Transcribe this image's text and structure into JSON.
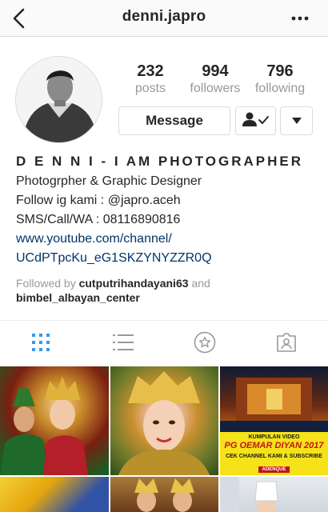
{
  "header": {
    "username": "denni.japro",
    "back_icon": "chevron-left-icon",
    "more_icon": "more-dots-icon"
  },
  "profile": {
    "avatar": "profile-photo",
    "stats": [
      {
        "value": "232",
        "label": "posts"
      },
      {
        "value": "994",
        "label": "followers"
      },
      {
        "value": "796",
        "label": "following"
      }
    ],
    "message_label": "Message",
    "following_icon": "person-check-icon",
    "dropdown_icon": "triangle-down-icon"
  },
  "bio": {
    "name": "D E N N I - I AM PHOTOGRAPHER",
    "lines": [
      "Photogrpher & Graphic Designer",
      "Follow ig kami : @japro.aceh",
      "SMS/Call/WA : 08116890816"
    ],
    "link_line1": "www.youtube.com/channel/",
    "link_line2": "UCdPTpcKu_eG1SKZYNYZZR0Q",
    "followed_prefix": "Followed by",
    "followed_user1": "cutputrihandayani63",
    "followed_and": "and",
    "followed_user2": "bimbel_albayan_center"
  },
  "tabs": [
    {
      "name": "grid",
      "icon": "grid-icon",
      "active": true
    },
    {
      "name": "list",
      "icon": "list-icon",
      "active": false
    },
    {
      "name": "saved",
      "icon": "star-badge-icon",
      "active": false
    },
    {
      "name": "tagged",
      "icon": "tagged-person-icon",
      "active": false
    }
  ],
  "posts": {
    "promo": {
      "small_top": "KUMPULAN VIDEO",
      "big": "PG OEMAR DIYAN 2017",
      "small_bottom": "CEK CHANNEL KAMI & SUBSCRIBE",
      "tag": "ADENQUE"
    }
  },
  "colors": {
    "accent_active": "#3897f0",
    "link": "#003569",
    "muted": "#999999",
    "border": "#dbdbdb"
  }
}
